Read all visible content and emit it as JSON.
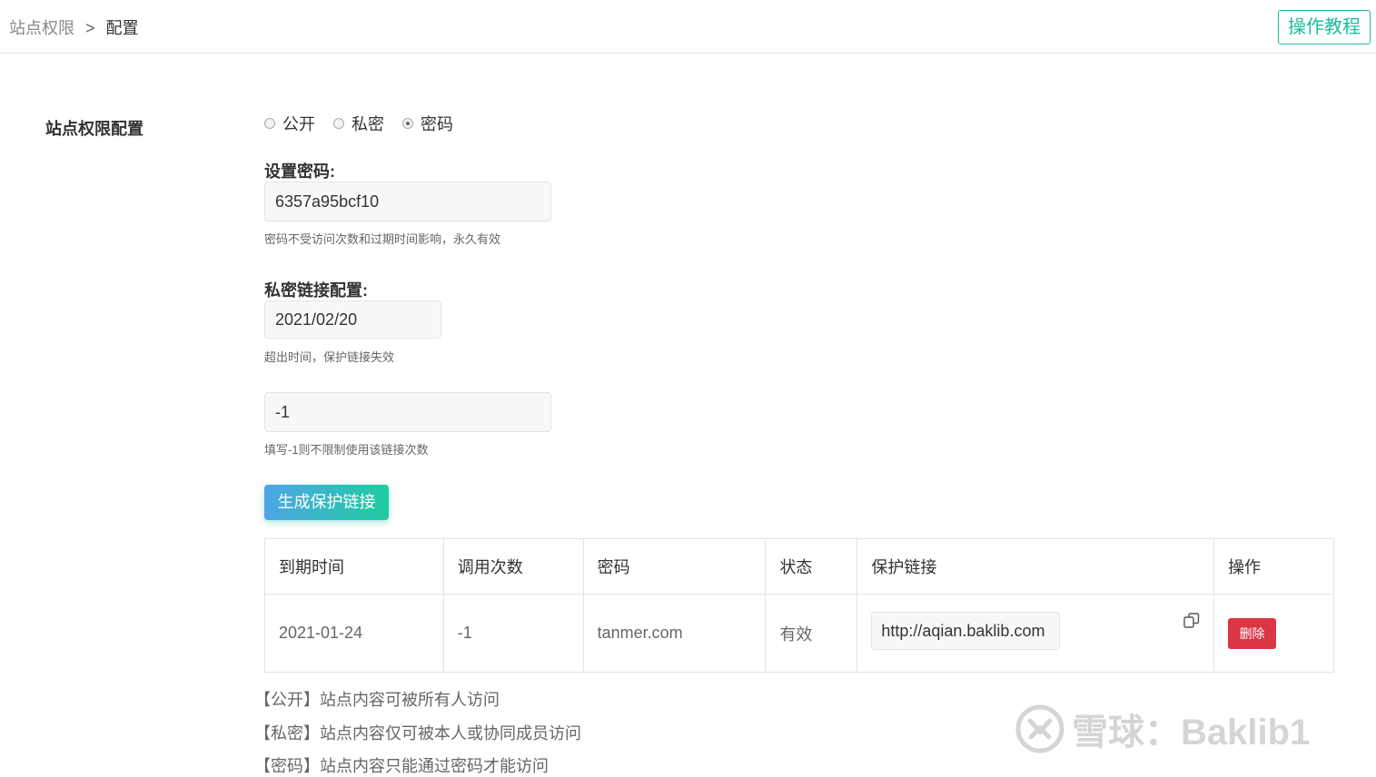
{
  "breadcrumb": {
    "parent": "站点权限",
    "separator": ">",
    "current": "配置"
  },
  "header": {
    "tutorial_label": "操作教程"
  },
  "section": {
    "title": "站点权限配置"
  },
  "access_options": [
    {
      "label": "公开",
      "checked": false
    },
    {
      "label": "私密",
      "checked": false
    },
    {
      "label": "密码",
      "checked": true
    }
  ],
  "password": {
    "label": "设置密码:",
    "value": "6357a95bcf10",
    "hint": "密码不受访问次数和过期时间影响，永久有效"
  },
  "private_link": {
    "label": "私密链接配置:",
    "expiry_value": "2021/02/20",
    "expiry_hint": "超出时间，保护链接失效",
    "count_value": "-1",
    "count_hint": "填写-1则不限制使用该链接次数"
  },
  "generate_label": "生成保护链接",
  "table": {
    "headers": [
      "到期时间",
      "调用次数",
      "密码",
      "状态",
      "保护链接",
      "操作"
    ],
    "rows": [
      {
        "expiry": "2021-01-24",
        "count": "-1",
        "password": "tanmer.com",
        "status": "有效",
        "link": "http://aqian.baklib.com",
        "action": "删除"
      }
    ]
  },
  "descriptions": [
    "【公开】站点内容可被所有人访问",
    "【私密】站点内容仅可被本人或协同成员访问",
    "【密码】站点内容只能通过密码才能访问"
  ],
  "watermark": {
    "text": "雪球：Baklib1"
  },
  "colors": {
    "accent": "#1bbc9b",
    "danger": "#dc3545",
    "gradient_start": "#4ea5e6",
    "gradient_end": "#1fcc9f"
  }
}
